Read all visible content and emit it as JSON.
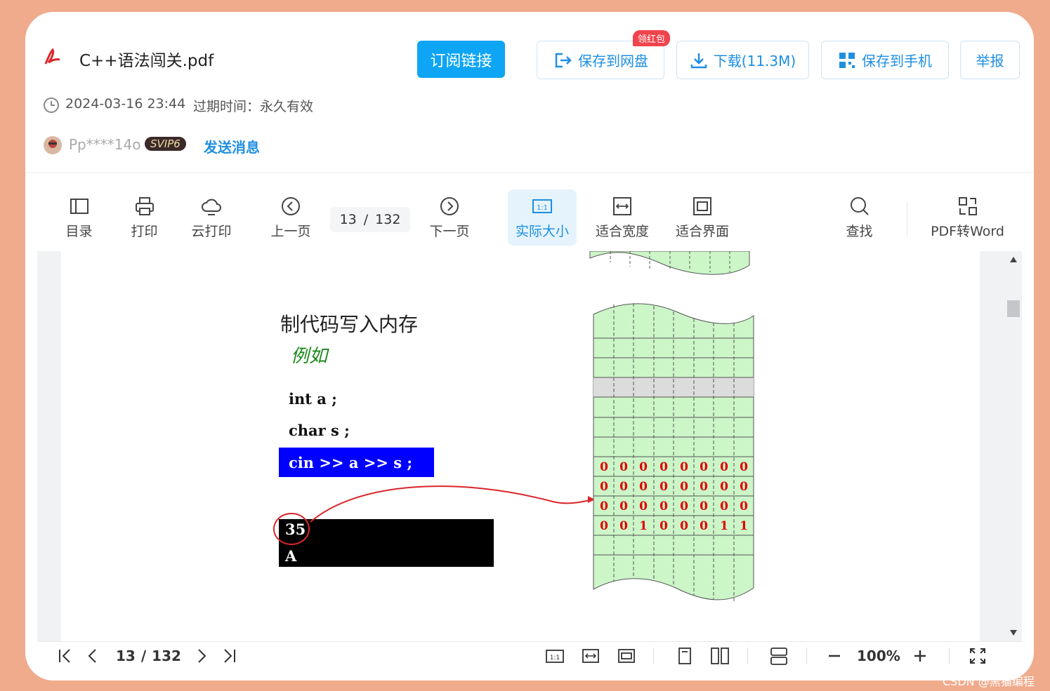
{
  "file": {
    "name": "C++语法闯关.pdf",
    "icon": "pdf-file-icon"
  },
  "buttons": {
    "subscribe": "订阅链接",
    "save_cloud": "保存到网盘",
    "save_cloud_badge": "领红包",
    "download": "下载(11.3M)",
    "save_phone": "保存到手机",
    "report": "举报"
  },
  "meta": {
    "date": "2024-03-16 23:44",
    "expiry": "过期时间：永久有效"
  },
  "user": {
    "name": "Pp****14o",
    "vip": "SVIP6",
    "send_message": "发送消息"
  },
  "toolbar": {
    "toc": "目录",
    "print": "打印",
    "cloud_print": "云打印",
    "prev": "上一页",
    "page_current": "13",
    "page_sep": "/",
    "page_total": "132",
    "next": "下一页",
    "actual_size": "实际大小",
    "fit_width": "适合宽度",
    "fit_page": "适合界面",
    "find": "查找",
    "pdf_to_word": "PDF转Word",
    "actual_icon_text": "1:1"
  },
  "document": {
    "heading": "制代码写入内存",
    "example": "例如",
    "code_line1": "int  a ;",
    "code_line2": "char  s ;",
    "code_line3": "cin >> a >> s ;",
    "input_value1": "35",
    "input_value2": "A",
    "memory_rows": [
      [
        "0",
        "0",
        "0",
        "0",
        "0",
        "0",
        "0",
        "0"
      ],
      [
        "0",
        "0",
        "0",
        "0",
        "0",
        "0",
        "0",
        "0"
      ],
      [
        "0",
        "0",
        "0",
        "0",
        "0",
        "0",
        "0",
        "0"
      ],
      [
        "0",
        "0",
        "1",
        "0",
        "0",
        "0",
        "1",
        "1"
      ]
    ]
  },
  "bottombar": {
    "page_current": "13",
    "page_sep": "/",
    "page_total": "132",
    "zoom": "100%",
    "actual_icon_text": "1:1"
  },
  "watermark": "CSDN @黑猫编程",
  "colors": {
    "accent": "#1e8fe1",
    "primary_button": "#0ea5f4",
    "background": "#f0ab8d",
    "memory_green": "#ccf5c8",
    "code_blue": "#0000ff"
  }
}
